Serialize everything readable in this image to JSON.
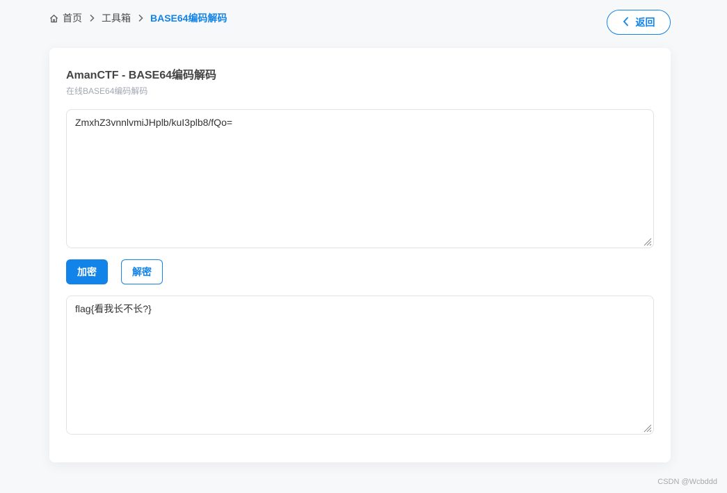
{
  "breadcrumb": {
    "home": "首页",
    "toolbox": "工具箱",
    "current": "BASE64编码解码"
  },
  "header": {
    "back_label": "返回"
  },
  "card": {
    "title": "AmanCTF - BASE64编码解码",
    "subtitle": "在线BASE64编码解码"
  },
  "input": {
    "value": "ZmxhZ3vnnlvmiJHplb/kuI3plb8/fQo="
  },
  "actions": {
    "encode_label": "加密",
    "decode_label": "解密"
  },
  "output": {
    "value": "flag{看我长不长?}"
  },
  "watermark": "CSDN @Wcbddd",
  "colors": {
    "accent": "#1283e8",
    "background": "#f7f8fa"
  },
  "icons": {
    "home": "home-icon",
    "separator": "chevron-right-icon",
    "back": "chevron-left-icon"
  }
}
